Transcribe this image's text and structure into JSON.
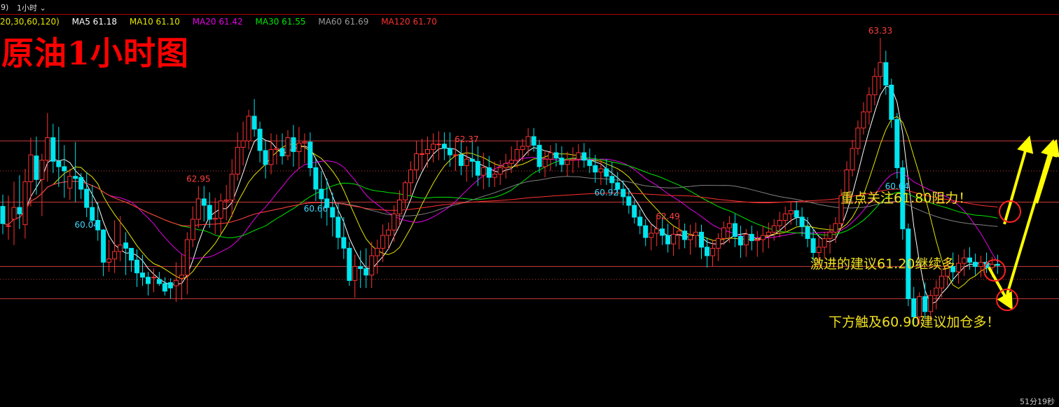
{
  "topbar": {
    "left_fragment": "9)",
    "period_label": "1小时",
    "dropdown_icon": "chevron-down-icon"
  },
  "ma_legend": {
    "params_label": "20,30,60,120)",
    "items": [
      {
        "label": "MA5 61.18",
        "color": "#ffffff"
      },
      {
        "label": "MA10 61.10",
        "color": "#e6e600"
      },
      {
        "label": "MA20 61.42",
        "color": "#e600e6"
      },
      {
        "label": "MA30 61.55",
        "color": "#00e600"
      },
      {
        "label": "MA60 61.69",
        "color": "#9a9a9a"
      },
      {
        "label": "MA120 61.70",
        "color": "#ff3030"
      }
    ]
  },
  "title": "原油1小时图",
  "annotations": [
    "重点关注61.80阻力！",
    "激进的建议61.20继续多",
    "下方触及60.90建议加仓多！"
  ],
  "timer": "51分19秒",
  "colors": {
    "up": "#ff3232",
    "down": "#00e5ee",
    "price_label_high": "#ff4040",
    "price_label_low": "#40d8ff",
    "hline": "#c83c3c",
    "arrow": "#ffff00",
    "circle": "#ff2020"
  },
  "chart_data": {
    "type": "candlestick",
    "ylim": [
      59.93,
      63.5
    ],
    "x_count": 184,
    "candles": [
      [
        61.76,
        61.87,
        61.5,
        61.6
      ],
      [
        61.58,
        61.86,
        61.45,
        61.58
      ],
      [
        61.64,
        61.99,
        61.4,
        61.75
      ],
      [
        61.75,
        62.05,
        61.55,
        61.69
      ],
      [
        61.59,
        62.11,
        61.46,
        61.99
      ],
      [
        61.99,
        62.4,
        61.76,
        62.24
      ],
      [
        62.23,
        62.41,
        61.87,
        62.01
      ],
      [
        62.01,
        62.25,
        61.67,
        62.19
      ],
      [
        62.19,
        62.63,
        61.99,
        62.4
      ],
      [
        62.4,
        62.53,
        62.07,
        62.18
      ],
      [
        62.18,
        62.5,
        61.94,
        62.13
      ],
      [
        62.13,
        62.33,
        61.84,
        62.09
      ],
      [
        61.93,
        62.11,
        61.82,
        62.04
      ],
      [
        62.04,
        62.36,
        61.8,
        62.02
      ],
      [
        62.03,
        62.07,
        61.83,
        61.92
      ],
      [
        61.92,
        62.08,
        61.66,
        61.75
      ],
      [
        61.75,
        61.96,
        61.58,
        61.63
      ],
      [
        61.63,
        61.8,
        61.44,
        61.54
      ],
      [
        61.54,
        61.55,
        61.11,
        61.24
      ],
      [
        61.24,
        61.45,
        61.15,
        61.27
      ],
      [
        61.27,
        61.63,
        61.14,
        61.34
      ],
      [
        61.34,
        61.67,
        61.25,
        61.4
      ],
      [
        61.42,
        61.52,
        61.12,
        61.37
      ],
      [
        61.37,
        61.37,
        61.15,
        61.26
      ],
      [
        61.26,
        61.36,
        61.01,
        61.14
      ],
      [
        61.14,
        61.31,
        61.02,
        61.1
      ],
      [
        61.1,
        61.15,
        60.93,
        61.04
      ],
      [
        61.1,
        61.18,
        60.96,
        61.1
      ],
      [
        61.08,
        61.15,
        61.02,
        61.04
      ],
      [
        61.04,
        61.1,
        60.93,
        60.97
      ],
      [
        61.05,
        61.09,
        60.9,
        61.0
      ],
      [
        61.02,
        61.24,
        60.87,
        61.07
      ],
      [
        61.09,
        61.31,
        60.89,
        61.12
      ],
      [
        61.12,
        61.52,
        60.94,
        61.45
      ],
      [
        61.45,
        61.76,
        61.38,
        61.64
      ],
      [
        61.64,
        61.95,
        61.56,
        61.83
      ],
      [
        61.83,
        61.95,
        61.62,
        61.77
      ],
      [
        61.77,
        61.89,
        61.56,
        61.64
      ],
      [
        61.64,
        61.84,
        61.5,
        61.65
      ],
      [
        61.65,
        61.88,
        61.51,
        61.81
      ],
      [
        61.81,
        61.96,
        61.63,
        61.82
      ],
      [
        61.82,
        62.2,
        61.66,
        62.06
      ],
      [
        62.06,
        62.45,
        62.0,
        62.31
      ],
      [
        62.31,
        62.55,
        62.14,
        62.37
      ],
      [
        62.37,
        62.66,
        62.29,
        62.6
      ],
      [
        62.6,
        62.76,
        62.41,
        62.48
      ],
      [
        62.48,
        62.55,
        62.17,
        62.28
      ],
      [
        62.28,
        62.37,
        62.02,
        62.15
      ],
      [
        62.15,
        62.44,
        62.06,
        62.29
      ],
      [
        62.29,
        62.43,
        62.15,
        62.3
      ],
      [
        62.3,
        62.44,
        62.15,
        62.23
      ],
      [
        62.23,
        62.47,
        62.19,
        62.4
      ],
      [
        62.4,
        62.52,
        62.13,
        62.27
      ],
      [
        62.27,
        62.5,
        62.11,
        62.35
      ],
      [
        62.35,
        62.44,
        62.16,
        62.36
      ],
      [
        62.36,
        62.45,
        62.04,
        62.12
      ],
      [
        62.12,
        62.2,
        61.81,
        61.92
      ],
      [
        61.92,
        62.09,
        61.65,
        61.83
      ],
      [
        61.83,
        62.02,
        61.58,
        61.75
      ],
      [
        61.75,
        61.89,
        61.48,
        61.66
      ],
      [
        61.66,
        61.79,
        61.36,
        61.47
      ],
      [
        61.47,
        61.66,
        61.27,
        61.37
      ],
      [
        61.37,
        61.43,
        61.02,
        61.07
      ],
      [
        61.07,
        61.31,
        60.91,
        61.2
      ],
      [
        61.2,
        61.35,
        61.0,
        61.18
      ],
      [
        61.18,
        61.37,
        61.0,
        61.12
      ],
      [
        61.12,
        61.43,
        61.0,
        61.3
      ],
      [
        61.3,
        61.45,
        61.13,
        61.37
      ],
      [
        61.37,
        61.59,
        61.24,
        61.49
      ],
      [
        61.49,
        61.61,
        61.36,
        61.54
      ],
      [
        61.54,
        61.77,
        61.43,
        61.69
      ],
      [
        61.69,
        61.91,
        61.58,
        61.82
      ],
      [
        61.82,
        62.0,
        61.74,
        61.98
      ],
      [
        61.98,
        62.18,
        61.86,
        62.1
      ],
      [
        62.1,
        62.37,
        62.01,
        62.25
      ],
      [
        62.25,
        62.39,
        62.1,
        62.25
      ],
      [
        62.25,
        62.41,
        62.12,
        62.29
      ],
      [
        62.29,
        62.44,
        62.17,
        62.34
      ],
      [
        62.34,
        62.46,
        62.19,
        62.34
      ],
      [
        62.34,
        62.45,
        62.19,
        62.3
      ],
      [
        62.3,
        62.45,
        62.13,
        62.24
      ],
      [
        62.24,
        62.37,
        62.09,
        62.24
      ],
      [
        62.24,
        62.38,
        62.05,
        62.14
      ],
      [
        62.14,
        62.32,
        61.99,
        62.2
      ],
      [
        62.2,
        62.37,
        62.03,
        62.18
      ],
      [
        62.18,
        62.32,
        61.95,
        62.05
      ],
      [
        62.05,
        62.26,
        61.92,
        62.12
      ],
      [
        62.12,
        62.23,
        61.94,
        62.03
      ],
      [
        62.03,
        62.18,
        61.94,
        62.06
      ],
      [
        62.06,
        62.19,
        61.96,
        62.12
      ],
      [
        62.12,
        62.25,
        62.02,
        62.16
      ],
      [
        62.16,
        62.32,
        62.07,
        62.19
      ],
      [
        62.19,
        62.37,
        62.12,
        62.29
      ],
      [
        62.29,
        62.39,
        62.18,
        62.32
      ],
      [
        62.32,
        62.49,
        62.23,
        62.41
      ],
      [
        62.41,
        62.49,
        62.27,
        62.33
      ],
      [
        62.33,
        62.38,
        62.07,
        62.13
      ],
      [
        62.13,
        62.28,
        62.03,
        62.2
      ],
      [
        62.2,
        62.33,
        62.09,
        62.26
      ],
      [
        62.26,
        62.35,
        62.13,
        62.21
      ],
      [
        62.21,
        62.32,
        62.08,
        62.15
      ],
      [
        62.15,
        62.27,
        62.04,
        62.19
      ],
      [
        62.19,
        62.31,
        62.07,
        62.2
      ],
      [
        62.2,
        62.34,
        62.12,
        62.26
      ],
      [
        62.26,
        62.35,
        62.12,
        62.19
      ],
      [
        62.19,
        62.3,
        62.07,
        62.14
      ],
      [
        62.14,
        62.24,
        61.98,
        62.08
      ],
      [
        62.08,
        62.19,
        61.96,
        62.11
      ],
      [
        62.11,
        62.2,
        61.96,
        62.04
      ],
      [
        62.04,
        62.17,
        61.9,
        61.98
      ],
      [
        61.98,
        62.08,
        61.86,
        61.92
      ],
      [
        61.92,
        62.0,
        61.77,
        61.85
      ],
      [
        61.85,
        61.93,
        61.69,
        61.77
      ],
      [
        61.77,
        61.82,
        61.6,
        61.66
      ],
      [
        61.66,
        61.73,
        61.5,
        61.58
      ],
      [
        61.58,
        61.64,
        61.39,
        61.47
      ],
      [
        61.47,
        61.6,
        61.35,
        61.51
      ],
      [
        61.51,
        61.65,
        61.39,
        61.55
      ],
      [
        61.55,
        61.66,
        61.4,
        61.49
      ],
      [
        61.49,
        61.6,
        61.33,
        61.41
      ],
      [
        61.41,
        61.58,
        61.3,
        61.5
      ],
      [
        61.5,
        61.64,
        61.36,
        61.53
      ],
      [
        61.53,
        61.6,
        61.37,
        61.45
      ],
      [
        61.45,
        61.59,
        61.31,
        61.49
      ],
      [
        61.49,
        61.61,
        61.38,
        61.52
      ],
      [
        61.52,
        61.59,
        61.27,
        61.38
      ],
      [
        61.38,
        61.47,
        61.19,
        61.3
      ],
      [
        61.3,
        61.45,
        61.2,
        61.37
      ],
      [
        61.37,
        61.51,
        61.25,
        61.46
      ],
      [
        61.46,
        61.62,
        61.4,
        61.56
      ],
      [
        61.56,
        61.67,
        61.42,
        61.6
      ],
      [
        61.6,
        61.69,
        61.38,
        61.48
      ],
      [
        61.48,
        61.58,
        61.28,
        61.4
      ],
      [
        61.4,
        61.55,
        61.29,
        61.5
      ],
      [
        61.5,
        61.58,
        61.35,
        61.44
      ],
      [
        61.44,
        61.53,
        61.29,
        61.45
      ],
      [
        61.45,
        61.58,
        61.33,
        61.49
      ],
      [
        61.49,
        61.61,
        61.37,
        61.52
      ],
      [
        61.52,
        61.64,
        61.44,
        61.58
      ],
      [
        61.58,
        61.71,
        61.47,
        61.63
      ],
      [
        61.63,
        61.76,
        61.52,
        61.69
      ],
      [
        61.69,
        61.8,
        61.59,
        61.72
      ],
      [
        61.72,
        61.81,
        61.58,
        61.66
      ],
      [
        61.66,
        61.75,
        61.48,
        61.57
      ],
      [
        61.57,
        61.66,
        61.38,
        61.46
      ],
      [
        61.46,
        61.55,
        61.25,
        61.33
      ],
      [
        61.33,
        61.47,
        61.2,
        61.38
      ],
      [
        61.38,
        61.52,
        61.28,
        61.46
      ],
      [
        61.46,
        61.59,
        61.32,
        61.52
      ],
      [
        61.52,
        61.66,
        61.42,
        61.6
      ],
      [
        61.6,
        61.92,
        61.55,
        61.86
      ],
      [
        61.86,
        62.18,
        61.8,
        62.1
      ],
      [
        62.1,
        62.38,
        62.04,
        62.3
      ],
      [
        62.3,
        62.56,
        62.24,
        62.49
      ],
      [
        62.49,
        62.73,
        62.43,
        62.64
      ],
      [
        62.64,
        62.87,
        62.52,
        62.8
      ],
      [
        62.8,
        63.05,
        62.7,
        62.97
      ],
      [
        62.97,
        63.33,
        62.85,
        63.1
      ],
      [
        63.1,
        63.21,
        62.8,
        62.89
      ],
      [
        62.89,
        62.95,
        62.49,
        62.57
      ],
      [
        62.57,
        62.63,
        62.02,
        62.12
      ],
      [
        62.12,
        62.19,
        61.45,
        61.55
      ],
      [
        61.55,
        61.6,
        60.83,
        60.9
      ],
      [
        60.9,
        61.01,
        60.64,
        60.73
      ],
      [
        60.73,
        60.96,
        60.66,
        60.92
      ],
      [
        60.92,
        61.05,
        60.72,
        60.78
      ],
      [
        60.78,
        60.98,
        60.7,
        60.93
      ],
      [
        60.93,
        61.07,
        60.8,
        61.0
      ],
      [
        61.0,
        61.18,
        60.91,
        61.11
      ],
      [
        61.11,
        61.27,
        61.02,
        61.2
      ],
      [
        61.2,
        61.33,
        61.06,
        61.15
      ],
      [
        61.15,
        61.31,
        61.04,
        61.23
      ],
      [
        61.23,
        61.36,
        61.11,
        61.28
      ],
      [
        61.28,
        61.38,
        61.17,
        61.24
      ],
      [
        61.24,
        61.32,
        61.12,
        61.2
      ],
      [
        61.2,
        61.3,
        61.1,
        61.24
      ],
      [
        61.24,
        61.33,
        61.14,
        61.19
      ],
      [
        61.19,
        61.29,
        61.1,
        61.22
      ],
      [
        61.22,
        61.31,
        61.13,
        61.21
      ]
    ],
    "hlines": [
      {
        "price": 62.37,
        "style": "solid"
      },
      {
        "price": 62.09,
        "style": "dotted"
      },
      {
        "price": 61.8,
        "style": "solid"
      },
      {
        "price": 61.2,
        "style": "solid"
      },
      {
        "price": 61.08,
        "style": "dotted"
      },
      {
        "price": 60.9,
        "style": "solid"
      }
    ],
    "price_labels": [
      {
        "text": "62.95",
        "index": 35,
        "kind": "high"
      },
      {
        "text": "62.37",
        "index": 83,
        "kind": "high"
      },
      {
        "text": "62.49",
        "index": 119,
        "kind": "high"
      },
      {
        "text": "63.33",
        "index": 157,
        "kind": "high"
      },
      {
        "text": "60.04",
        "index": 15,
        "kind": "low"
      },
      {
        "text": "60.66",
        "index": 56,
        "kind": "low"
      },
      {
        "text": "60.92",
        "index": 108,
        "kind": "low"
      },
      {
        "text": "60.64",
        "index": 160,
        "kind": "low"
      }
    ],
    "ma_series": [
      {
        "name": "MA5",
        "period": 5,
        "color": "#ffffff"
      },
      {
        "name": "MA10",
        "period": 10,
        "color": "#e6e600"
      },
      {
        "name": "MA20",
        "period": 20,
        "color": "#e600e6"
      },
      {
        "name": "MA30",
        "period": 30,
        "color": "#00e600"
      },
      {
        "name": "MA60",
        "period": 60,
        "color": "#808080"
      },
      {
        "name": "MA120",
        "period": 120,
        "color": "#ff3030"
      }
    ]
  }
}
